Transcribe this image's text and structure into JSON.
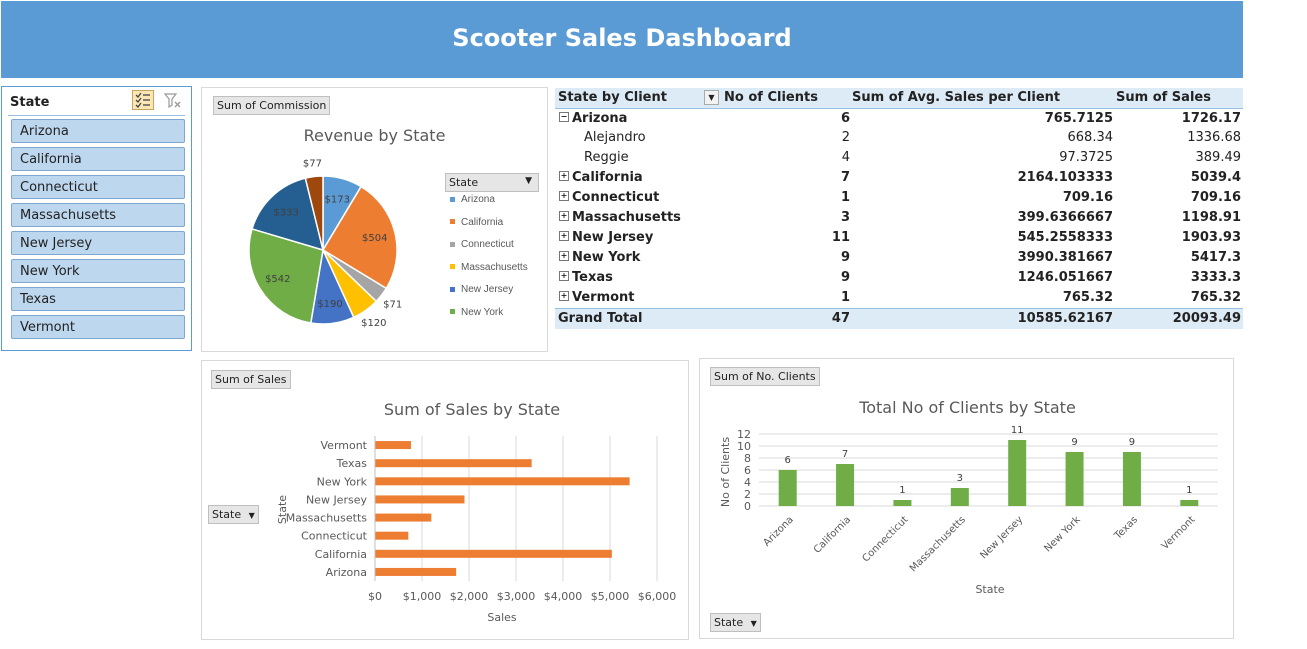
{
  "header": {
    "title": "Scooter Sales Dashboard"
  },
  "colors": {
    "header_bg": "#5b9bd5",
    "accent_orange": "#ed7d31",
    "accent_green": "#70ad47"
  },
  "slicer": {
    "title": "State",
    "multi_select_icon": "multi-select-icon",
    "clear_filter_icon": "clear-filter-icon",
    "items": [
      "Arizona",
      "California",
      "Connecticut",
      "Massachusetts",
      "New Jersey",
      "New York",
      "Texas",
      "Vermont"
    ]
  },
  "pie_panel": {
    "field_button": "Sum of Commission",
    "legend_button": "State"
  },
  "bar_panel": {
    "field_button": "Sum of Sales",
    "axis_button": "State"
  },
  "col_panel": {
    "field_button": "Sum of No. Clients",
    "axis_button": "State"
  },
  "pivot": {
    "headers": [
      "State by Client",
      "No of Clients",
      "Sum of Avg. Sales per Client",
      "Sum of Sales"
    ],
    "rows": [
      {
        "label": "Arizona",
        "clients": "6",
        "avg": "765.7125",
        "sales": "1726.17",
        "bold": true,
        "toggle": "−",
        "indent": false
      },
      {
        "label": "Alejandro",
        "clients": "2",
        "avg": "668.34",
        "sales": "1336.68",
        "bold": false,
        "toggle": "",
        "indent": true
      },
      {
        "label": "Reggie",
        "clients": "4",
        "avg": "97.3725",
        "sales": "389.49",
        "bold": false,
        "toggle": "",
        "indent": true
      },
      {
        "label": "California",
        "clients": "7",
        "avg": "2164.103333",
        "sales": "5039.4",
        "bold": true,
        "toggle": "+",
        "indent": false
      },
      {
        "label": "Connecticut",
        "clients": "1",
        "avg": "709.16",
        "sales": "709.16",
        "bold": true,
        "toggle": "+",
        "indent": false
      },
      {
        "label": "Massachusetts",
        "clients": "3",
        "avg": "399.6366667",
        "sales": "1198.91",
        "bold": true,
        "toggle": "+",
        "indent": false
      },
      {
        "label": "New Jersey",
        "clients": "11",
        "avg": "545.2558333",
        "sales": "1903.93",
        "bold": true,
        "toggle": "+",
        "indent": false
      },
      {
        "label": "New York",
        "clients": "9",
        "avg": "3990.381667",
        "sales": "5417.3",
        "bold": true,
        "toggle": "+",
        "indent": false
      },
      {
        "label": "Texas",
        "clients": "9",
        "avg": "1246.051667",
        "sales": "3333.3",
        "bold": true,
        "toggle": "+",
        "indent": false
      },
      {
        "label": "Vermont",
        "clients": "1",
        "avg": "765.32",
        "sales": "765.32",
        "bold": true,
        "toggle": "+",
        "indent": false
      }
    ],
    "total": {
      "label": "Grand Total",
      "clients": "47",
      "avg": "10585.62167",
      "sales": "20093.49"
    }
  },
  "chart_data": [
    {
      "type": "pie",
      "title": "Revenue by State",
      "legend_title": "State",
      "legend_position": "right",
      "categories": [
        "Arizona",
        "California",
        "Connecticut",
        "Massachusetts",
        "New Jersey",
        "New York",
        "Texas",
        "Vermont"
      ],
      "values": [
        173,
        504,
        71,
        120,
        190,
        542,
        333,
        77
      ],
      "labels": [
        "$173",
        "$504",
        "$71",
        "$120",
        "$190",
        "$542",
        "$333",
        "$77"
      ],
      "colors": [
        "#5b9bd5",
        "#ed7d31",
        "#a5a5a5",
        "#ffc000",
        "#4472c4",
        "#70ad47",
        "#255e91",
        "#9e480e"
      ]
    },
    {
      "type": "bar",
      "orientation": "horizontal",
      "title": "Sum of Sales by State",
      "xlabel": "Sales",
      "ylabel": "State",
      "categories": [
        "Arizona",
        "California",
        "Connecticut",
        "Massachusetts",
        "New Jersey",
        "New York",
        "Texas",
        "Vermont"
      ],
      "values": [
        1726.17,
        5039.4,
        709.16,
        1198.91,
        1903.93,
        5417.3,
        3333.3,
        765.32
      ],
      "xlim": [
        0,
        6000
      ],
      "xticks": [
        "$0",
        "$1,000",
        "$2,000",
        "$3,000",
        "$4,000",
        "$5,000",
        "$6,000"
      ],
      "color": "#ed7d31",
      "grid": true
    },
    {
      "type": "bar",
      "orientation": "vertical",
      "title": "Total No of Clients by State",
      "xlabel": "State",
      "ylabel": "No of Clients",
      "categories": [
        "Arizona",
        "California",
        "Connecticut",
        "Massachusetts",
        "New Jersey",
        "New York",
        "Texas",
        "Vermont"
      ],
      "values": [
        6,
        7,
        1,
        3,
        11,
        9,
        9,
        1
      ],
      "ylim": [
        0,
        12
      ],
      "yticks": [
        "0",
        "2",
        "4",
        "6",
        "8",
        "10",
        "12"
      ],
      "color": "#70ad47",
      "grid": true
    }
  ]
}
